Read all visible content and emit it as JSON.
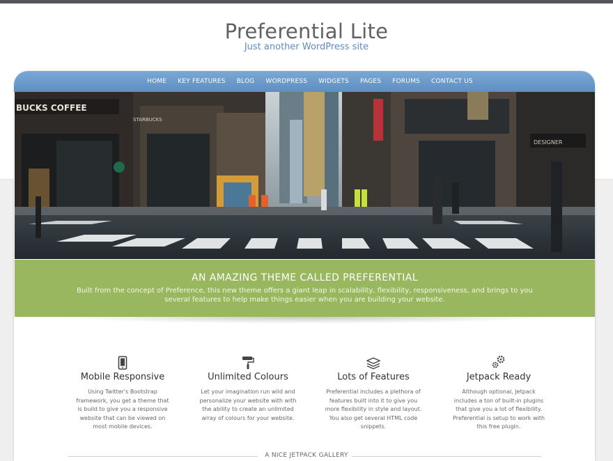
{
  "site": {
    "title": "Preferential Lite",
    "tagline": "Just another WordPress site"
  },
  "nav": {
    "items": [
      "HOME",
      "KEY FEATURES",
      "BLOG",
      "WORDPRESS",
      "WIDGETS",
      "PAGES",
      "FORUMS",
      "CONTACT US"
    ]
  },
  "hero": {
    "signs": {
      "coffee": "BUCKS COFFEE",
      "store": "STARBUCKS",
      "right_sign": "DESIGNER"
    }
  },
  "banner": {
    "title": "AN AMAZING THEME CALLED PREFERENTIAL",
    "text": "Built from the concept of Preference, this new theme offers a giant leap in scalability, flexibility, responsiveness, and brings to you several features to help make things easier when you are building your website."
  },
  "features": [
    {
      "icon": "mobile-phone-icon",
      "title": "Mobile Responsive",
      "text": "Using Twitter's Bootstrap framework, you get a theme that is build to give you a responsive website that can be viewed on most mobile devices."
    },
    {
      "icon": "paint-roller-icon",
      "title": "Unlimited Colours",
      "text": "Let your imagination run wild and personalize your website with with the ability to create an unlimited array of colours for your website."
    },
    {
      "icon": "layers-icon",
      "title": "Lots of Features",
      "text": "Preferential includes a plethora of features built into it to give you more flexibility in style and layout. You also get several HTML code snippets."
    },
    {
      "icon": "gears-icon",
      "title": "Jetpack Ready",
      "text": "Although optional, Jetpack includes a ton of built-in plugins that give you a lot of flexibility. Preferential is setup to work with this free plugin."
    }
  ],
  "gallery": {
    "title": "A NICE JETPACK GALLERY"
  },
  "colors": {
    "nav": "#6a9ccb",
    "banner": "#98b75f",
    "tagline": "#5b8cc0",
    "topbar": "#55555c"
  }
}
